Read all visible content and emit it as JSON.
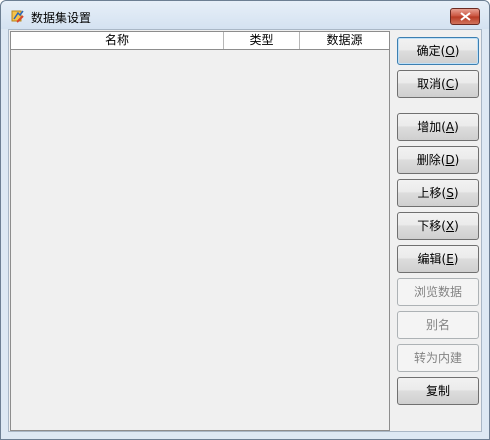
{
  "window": {
    "title": "数据集设置",
    "icon": "chart-edit-icon"
  },
  "table": {
    "columns": [
      "名称",
      "类型",
      "数据源"
    ],
    "rows": []
  },
  "buttons": {
    "ok": {
      "label": "确定(",
      "mnemonic": "O",
      "suffix": ")"
    },
    "cancel": {
      "label": "取消(",
      "mnemonic": "C",
      "suffix": ")"
    },
    "add": {
      "label": "增加(",
      "mnemonic": "A",
      "suffix": ")"
    },
    "delete": {
      "label": "删除(",
      "mnemonic": "D",
      "suffix": ")"
    },
    "move_up": {
      "label": "上移(",
      "mnemonic": "S",
      "suffix": ")"
    },
    "move_down": {
      "label": "下移(",
      "mnemonic": "X",
      "suffix": ")"
    },
    "edit": {
      "label": "编辑(",
      "mnemonic": "E",
      "suffix": ")"
    },
    "browse": {
      "label": "浏览数据"
    },
    "alias": {
      "label": "别名"
    },
    "to_builtin": {
      "label": "转为内建"
    },
    "copy": {
      "label": "复制"
    }
  },
  "colors": {
    "accent": "#3c7fb1",
    "close": "#c9503b",
    "disabled_text": "#838383"
  }
}
